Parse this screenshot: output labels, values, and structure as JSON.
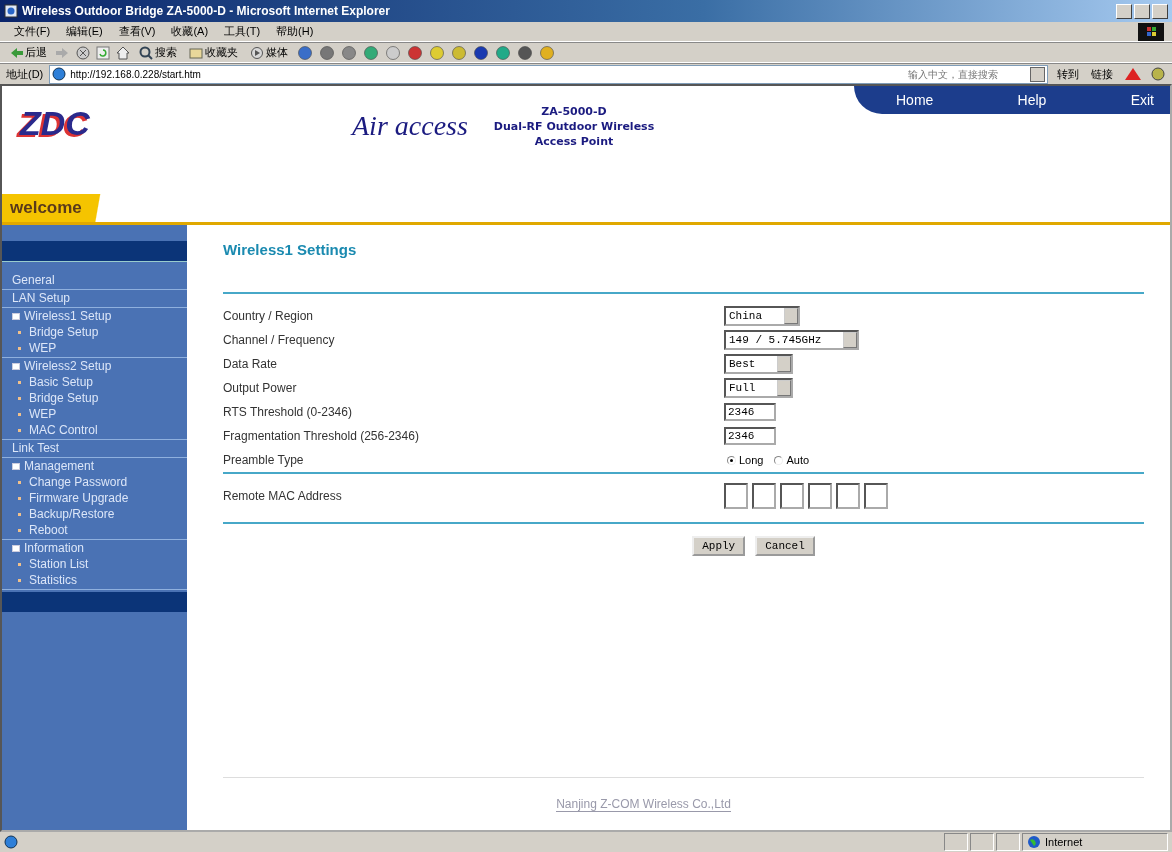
{
  "window": {
    "title": "Wireless Outdoor Bridge ZA-5000-D - Microsoft Internet Explorer"
  },
  "menu": [
    "文件(F)",
    "编辑(E)",
    "查看(V)",
    "收藏(A)",
    "工具(T)",
    "帮助(H)"
  ],
  "toolbar": [
    {
      "kind": "back",
      "label": "后退"
    },
    {
      "kind": "search",
      "label": "搜索"
    },
    {
      "kind": "favorites",
      "label": "收藏夹"
    },
    {
      "kind": "media",
      "label": "媒体"
    }
  ],
  "address": {
    "label": "地址(D)",
    "url": "http://192.168.0.228/start.htm",
    "search_placeholder": "输入中文，直接搜索",
    "go": "转到",
    "links": "链接"
  },
  "header": {
    "logo": "ZDC",
    "product_logo": "Air access",
    "model": "ZA-5000-D",
    "product_lines": [
      "Dual-RF Outdoor Wireless",
      "Access Point"
    ],
    "nav": [
      "Home",
      "Help",
      "Exit"
    ],
    "welcome": "welcome"
  },
  "sidebar": {
    "items": [
      {
        "label": "General",
        "kind": "link"
      },
      {
        "label": "LAN Setup",
        "kind": "link"
      },
      {
        "label": "Wireless1 Setup",
        "kind": "group",
        "children": [
          {
            "label": "Bridge Setup"
          },
          {
            "label": "WEP"
          }
        ]
      },
      {
        "label": "Wireless2 Setup",
        "kind": "group",
        "children": [
          {
            "label": "Basic Setup"
          },
          {
            "label": "Bridge Setup"
          },
          {
            "label": "WEP"
          },
          {
            "label": "MAC Control"
          }
        ]
      },
      {
        "label": "Link Test",
        "kind": "link"
      },
      {
        "label": "Management",
        "kind": "group",
        "children": [
          {
            "label": "Change Password"
          },
          {
            "label": "Firmware Upgrade"
          },
          {
            "label": "Backup/Restore"
          },
          {
            "label": "Reboot"
          }
        ]
      },
      {
        "label": "Information",
        "kind": "group",
        "children": [
          {
            "label": "Station List"
          },
          {
            "label": "Statistics"
          }
        ]
      }
    ]
  },
  "page_title": "Wireless1 Settings",
  "form": [
    {
      "label": "Country / Region",
      "kind": "select",
      "value": "China"
    },
    {
      "label": "Channel / Frequency",
      "kind": "select",
      "value": "149 / 5.745GHz"
    },
    {
      "label": "Data Rate",
      "kind": "select",
      "value": "Best"
    },
    {
      "label": "Output Power",
      "kind": "select",
      "value": "Full"
    },
    {
      "label": "RTS Threshold (0-2346)",
      "kind": "text",
      "value": "2346"
    },
    {
      "label": "Fragmentation Threshold (256-2346)",
      "kind": "text",
      "value": "2346"
    },
    {
      "label": "Preamble Type",
      "kind": "radio",
      "options": [
        {
          "label": "Long",
          "selected": true
        },
        {
          "label": "Auto",
          "selected": false
        }
      ]
    },
    {
      "label": "Remote MAC Address",
      "kind": "mac"
    }
  ],
  "buttons": [
    "Apply",
    "Cancel"
  ],
  "footer": "Nanjing Z-COM Wireless Co.,Ltd",
  "status_bar": {
    "zone": "Internet"
  }
}
